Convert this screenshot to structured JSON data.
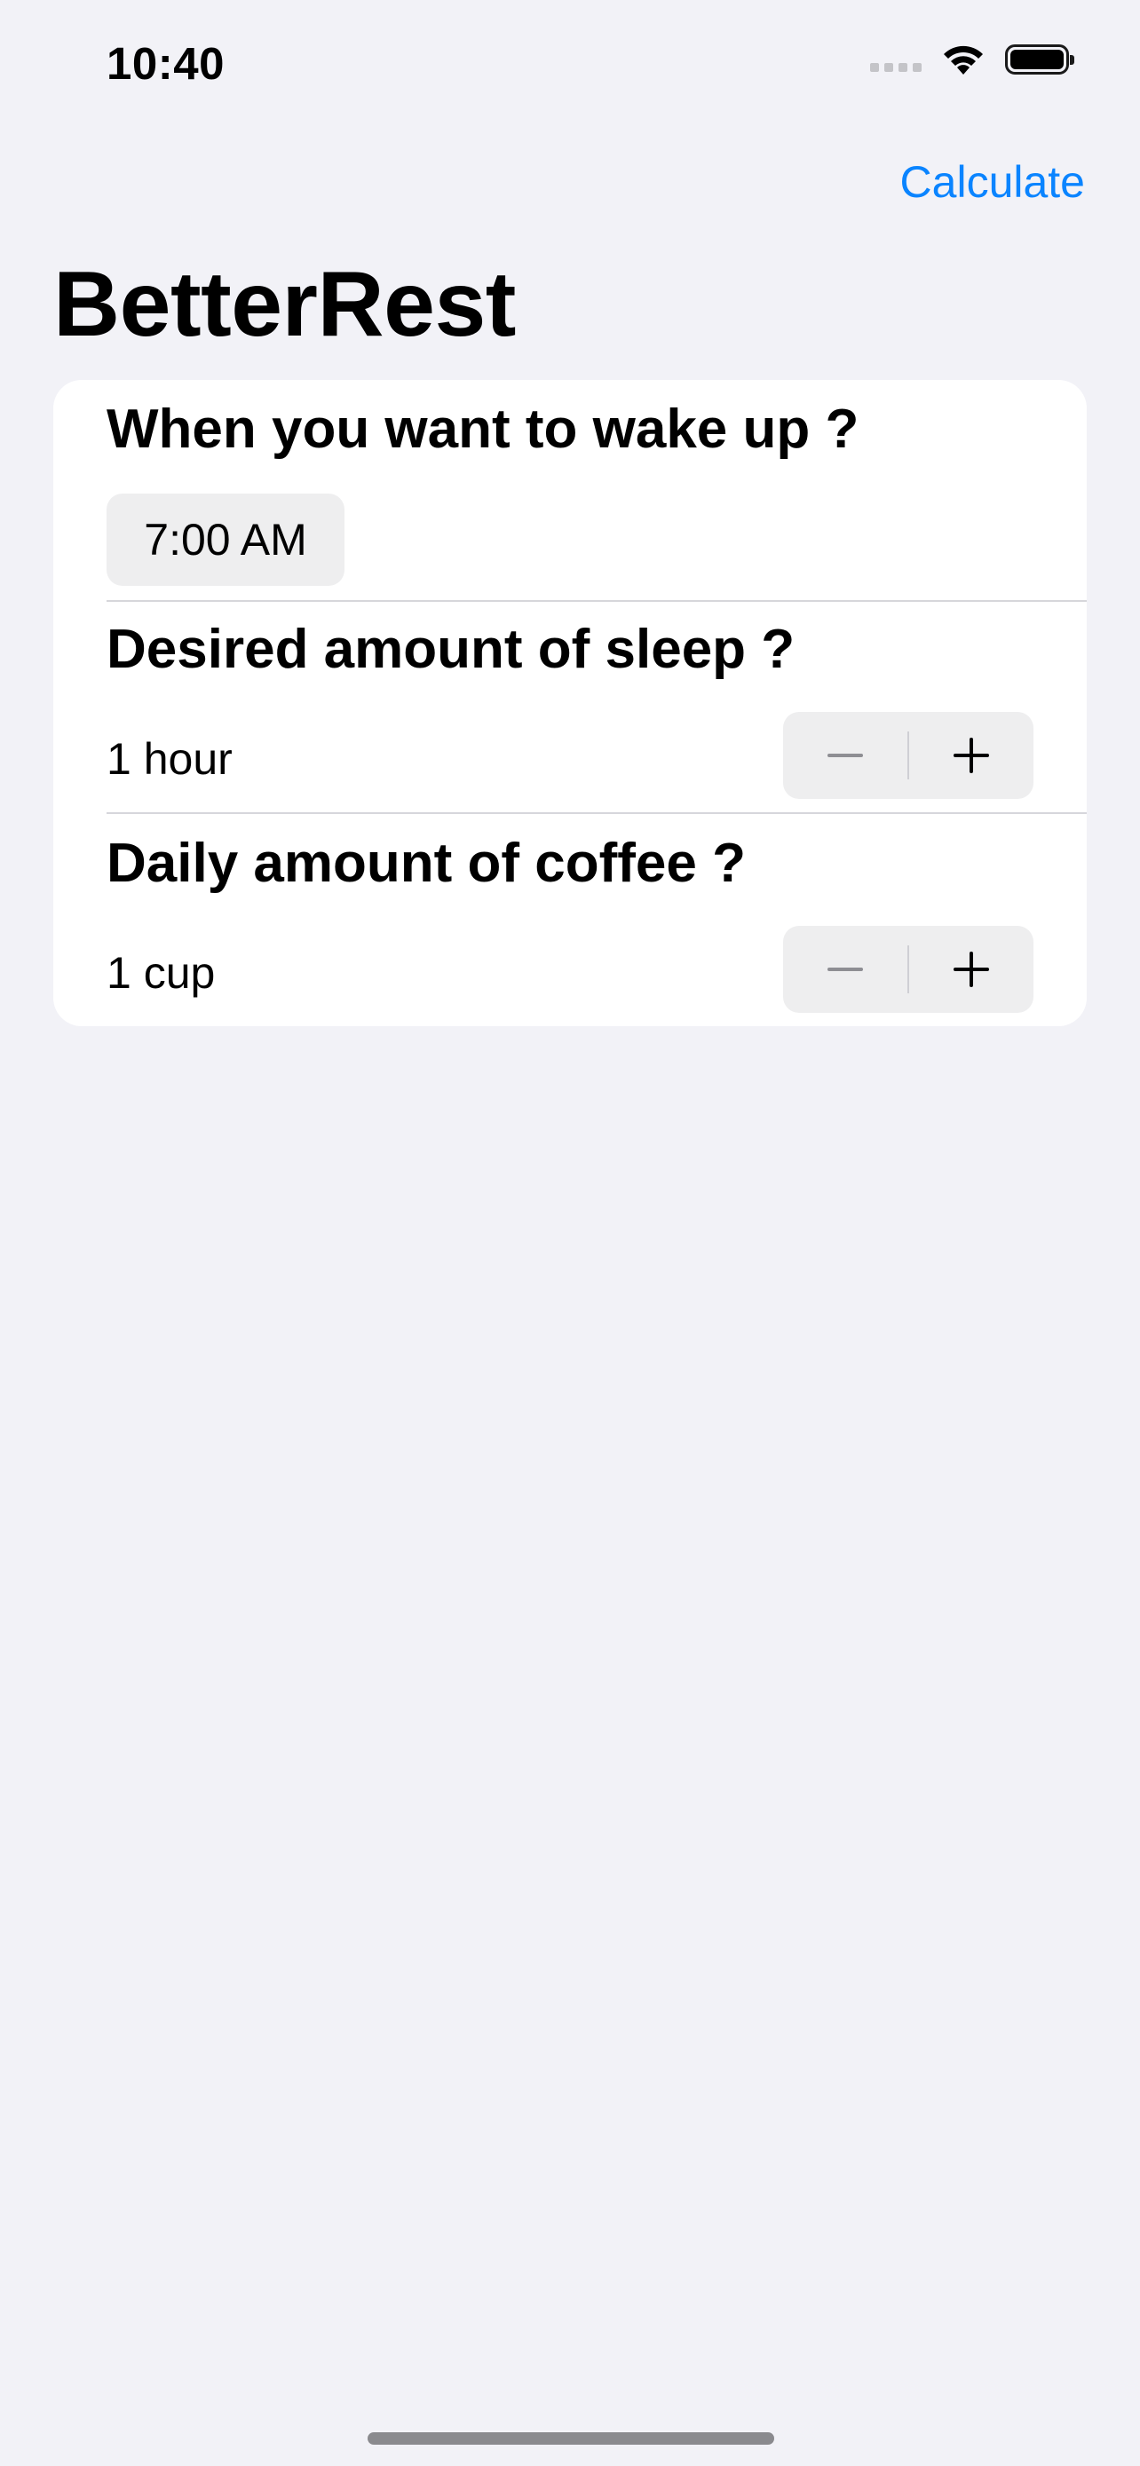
{
  "status_bar": {
    "time": "10:40"
  },
  "nav": {
    "calculate_label": "Calculate",
    "accent_color": "#0a84ff"
  },
  "page": {
    "title": "BetterRest"
  },
  "form": {
    "wake_up": {
      "title": "When you want to wake up ?",
      "time_value": "7:00 AM"
    },
    "sleep": {
      "title": "Desired amount of sleep ?",
      "value": "1 hour"
    },
    "coffee": {
      "title": "Daily amount of coffee ?",
      "value": "1 cup"
    }
  },
  "icons": {
    "wifi": "wifi-icon",
    "battery": "battery-icon",
    "signal": "cellular-signal-icon",
    "minus": "minus-icon",
    "plus": "plus-icon"
  }
}
